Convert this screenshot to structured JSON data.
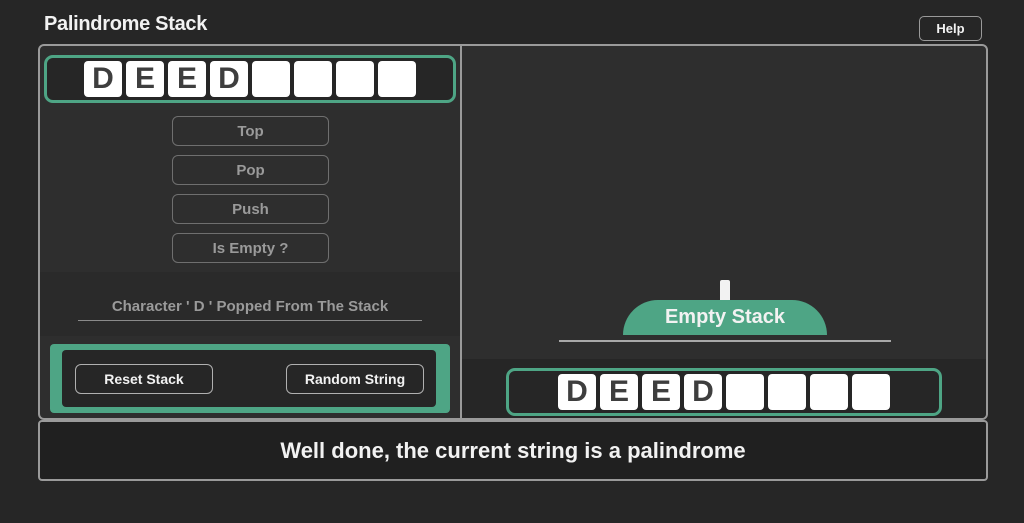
{
  "app": {
    "title": "Palindrome Stack",
    "help_label": "Help"
  },
  "colors": {
    "accent": "#4ea585",
    "background": "#262626",
    "panel": "#2e2e2e",
    "border": "#9a9a9a"
  },
  "input_string": {
    "cells": [
      "D",
      "E",
      "E",
      "D",
      "",
      "",
      "",
      ""
    ]
  },
  "operations": [
    {
      "label": "Top"
    },
    {
      "label": "Pop"
    },
    {
      "label": "Push"
    },
    {
      "label": "Is Empty ?"
    }
  ],
  "status_message": "Character ' D ' Popped From The Stack",
  "actions": {
    "reset_label": "Reset Stack",
    "random_label": "Random String"
  },
  "stack": {
    "label": "Empty Stack",
    "items": []
  },
  "output_string": {
    "cells": [
      "D",
      "E",
      "E",
      "D",
      "",
      "",
      "",
      ""
    ]
  },
  "result_message": "Well done, the current string is a palindrome"
}
